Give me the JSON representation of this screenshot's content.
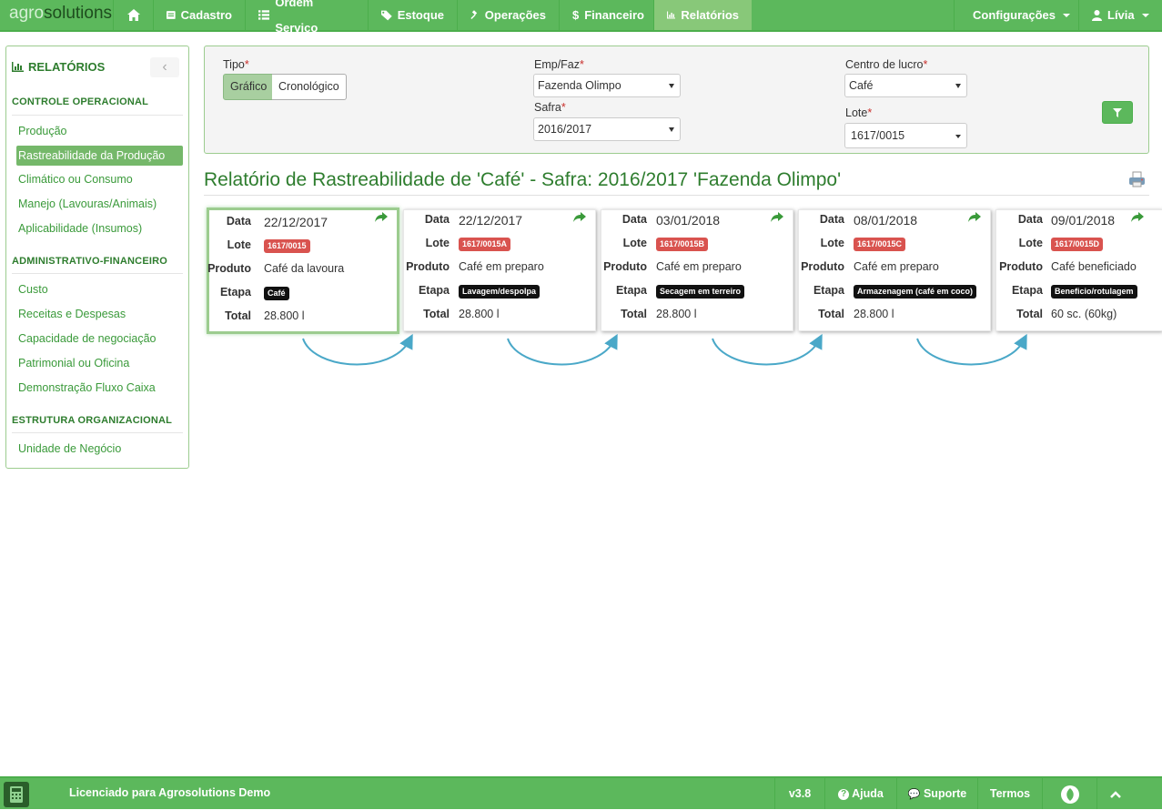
{
  "brand": {
    "part1": "agro",
    "part2": "solutions"
  },
  "nav": {
    "home_icon": "home-icon",
    "items": [
      {
        "label": "Cadastro",
        "icon": "table-icon"
      },
      {
        "label": "Ordem Serviço",
        "icon": "list-icon"
      },
      {
        "label": "Estoque",
        "icon": "tag-icon"
      },
      {
        "label": "Operações",
        "icon": "gavel-icon"
      },
      {
        "label": "Financeiro",
        "icon": "dollar-icon"
      },
      {
        "label": "Relatórios",
        "icon": "bar-chart-icon",
        "active": true
      }
    ],
    "config_label": "Configurações",
    "user_label": "Lívia"
  },
  "sidebar": {
    "title": "RELATÓRIOS",
    "sections": [
      {
        "title": "CONTROLE OPERACIONAL",
        "items": [
          "Produção",
          "Rastreabilidade da Produção",
          "Climático ou Consumo",
          "Manejo (Lavouras/Animais)",
          "Aplicabilidade (Insumos)"
        ]
      },
      {
        "title": "ADMINISTRATIVO-FINANCEIRO",
        "items": [
          "Custo",
          "Receitas e Despesas",
          "Capacidade de negociação",
          "Patrimonial ou Oficina",
          "Demonstração Fluxo Caixa"
        ]
      },
      {
        "title": "ESTRUTURA ORGANIZACIONAL",
        "items": [
          "Unidade de Negócio"
        ]
      }
    ],
    "active_item": "Rastreabilidade da Produção"
  },
  "filters": {
    "tipo_label": "Tipo",
    "tipo_options": [
      "Gráfico",
      "Cronológico"
    ],
    "tipo_selected": "Gráfico",
    "empfaz_label": "Emp/Faz",
    "empfaz_value": "Fazenda Olimpo",
    "safra_label": "Safra",
    "safra_value": "2016/2017",
    "centro_label": "Centro de lucro",
    "centro_value": "Café",
    "lote_label": "Lote",
    "lote_value": "1617/0015",
    "required_mark": "*"
  },
  "report": {
    "title": "Relatório de Rastreabilidade de 'Café' - Safra: 2016/2017 'Fazenda Olimpo'",
    "labels": {
      "data": "Data",
      "lote": "Lote",
      "produto": "Produto",
      "etapa": "Etapa",
      "total": "Total"
    },
    "cards": [
      {
        "data": "22/12/2017",
        "lote": "1617/0015",
        "produto": "Café da lavoura",
        "etapa": "Café",
        "total": "28.800 l"
      },
      {
        "data": "22/12/2017",
        "lote": "1617/0015A",
        "produto": "Café em preparo",
        "etapa": "Lavagem/despolpa",
        "total": "28.800 l"
      },
      {
        "data": "03/01/2018",
        "lote": "1617/0015B",
        "produto": "Café em preparo",
        "etapa": "Secagem em terreiro",
        "total": "28.800 l"
      },
      {
        "data": "08/01/2018",
        "lote": "1617/0015C",
        "produto": "Café em preparo",
        "etapa": "Armazenagem (café em coco)",
        "total": "28.800 l"
      },
      {
        "data": "09/01/2018",
        "lote": "1617/0015D",
        "produto": "Café beneficiado",
        "etapa": "Beneficio/rotulagem",
        "total": "60 sc. (60kg)"
      }
    ]
  },
  "footer": {
    "license": "Licenciado para Agrosolutions Demo",
    "version": "v3.8",
    "help": "Ajuda",
    "support": "Suporte",
    "terms": "Termos"
  },
  "colors": {
    "brand_green": "#5cb85c",
    "active_nav": "#88c879",
    "title_green": "#2e7d2e",
    "arrow_blue": "#4aa8c8",
    "badge_red": "#d9534f"
  }
}
